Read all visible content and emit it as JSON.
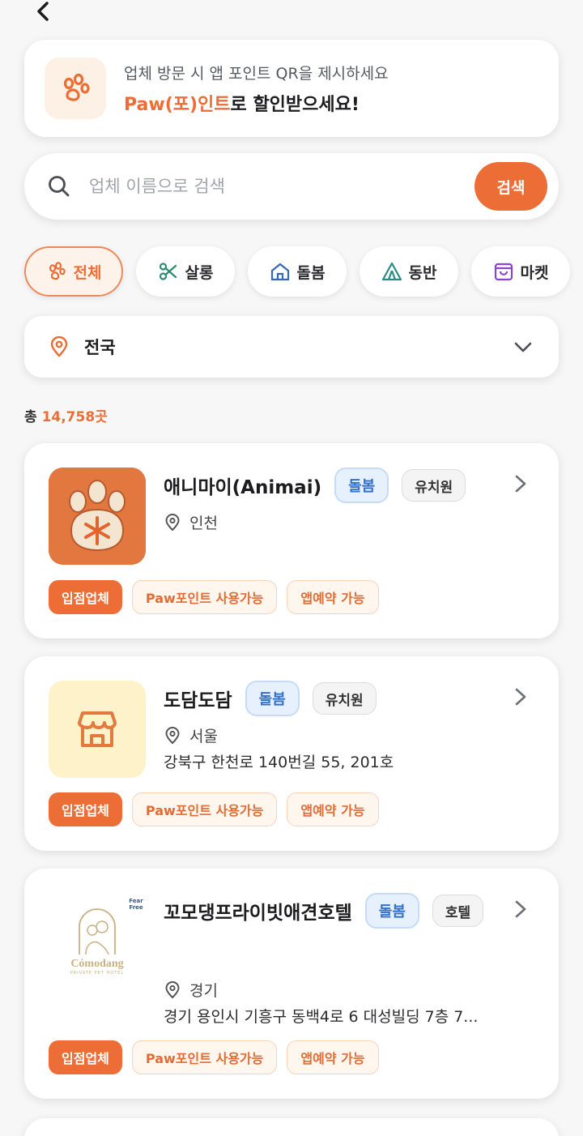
{
  "header": {
    "back_label": "back"
  },
  "promo": {
    "line1": "업체 방문 시 앱 포인트 QR을 제시하세요",
    "line2_accent": "Paw(포)인트",
    "line2_rest": "로 할인받으세요!"
  },
  "search": {
    "placeholder": "업체 이름으로 검색",
    "value": "",
    "button_label": "검색"
  },
  "categories": [
    {
      "label": "전체",
      "icon": "paw-icon",
      "active": true
    },
    {
      "label": "살롱",
      "icon": "scissors-icon",
      "active": false
    },
    {
      "label": "돌봄",
      "icon": "house-icon",
      "active": false
    },
    {
      "label": "동반",
      "icon": "tent-icon",
      "active": false
    },
    {
      "label": "마켓",
      "icon": "shopping-bag-icon",
      "active": false
    }
  ],
  "region": {
    "label": "전국"
  },
  "summary": {
    "prefix": "총",
    "count": "14,758곳"
  },
  "businesses": [
    {
      "name": "애니마이(Animai)",
      "category_badge": "돌봄",
      "type_badge": "유치원",
      "location": "인천",
      "address": "",
      "tags": {
        "partner": "입점업체",
        "points": "Paw포인트 사용가능",
        "booking": "앱예약 가능"
      }
    },
    {
      "name": "도담도담",
      "category_badge": "돌봄",
      "type_badge": "유치원",
      "location": "서울",
      "address": "강북구 한천로 140번길 55, 201호",
      "tags": {
        "partner": "입점업체",
        "points": "Paw포인트 사용가능",
        "booking": "앱예약 가능"
      }
    },
    {
      "name": "꼬모댕프라이빗애견호텔",
      "category_badge": "돌봄",
      "type_badge": "호텔",
      "location": "경기",
      "address": "경기 용인시 기흥구 동백4로 6 대성빌딩 7층 7...",
      "logo_text": "Cómodang",
      "logo_subtext": "PRIVATE PET HOTEL",
      "logo_badge": "Fear Free",
      "tags": {
        "partner": "입점업체",
        "points": "Paw포인트 사용가능",
        "booking": "앱예약 가능"
      }
    }
  ],
  "colors": {
    "accent": "#ec6d35",
    "badge_blue": "#3271c8",
    "background": "#f7f7f8"
  }
}
